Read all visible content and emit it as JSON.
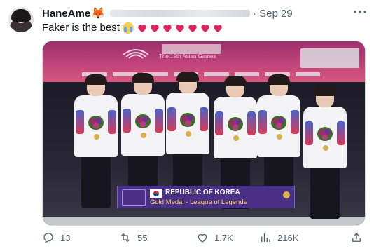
{
  "author": {
    "display_name": "HaneAme",
    "name_emoji": "🦊",
    "date": "Sep 29",
    "more_icon": "more-dots-icon"
  },
  "tweet": {
    "text": "Faker is the best",
    "emojis": [
      "loudly-crying-face",
      "red-heart",
      "red-heart",
      "red-heart",
      "red-heart",
      "red-heart",
      "red-heart",
      "red-heart"
    ]
  },
  "media": {
    "banner_text": "The 19th Asian Games",
    "caption_country": "REPUBLIC OF KOREA",
    "caption_event": "Gold Medal - League of Legends",
    "players_count": 6
  },
  "actions": {
    "replies": "13",
    "retweets": "55",
    "likes": "1.7K",
    "views": "216K"
  },
  "colors": {
    "text_primary": "#0f1419",
    "text_secondary": "#536471",
    "heart_red": "#e0245e",
    "caption_bg": "#4a2f86",
    "caption_event": "#ffd66b"
  }
}
